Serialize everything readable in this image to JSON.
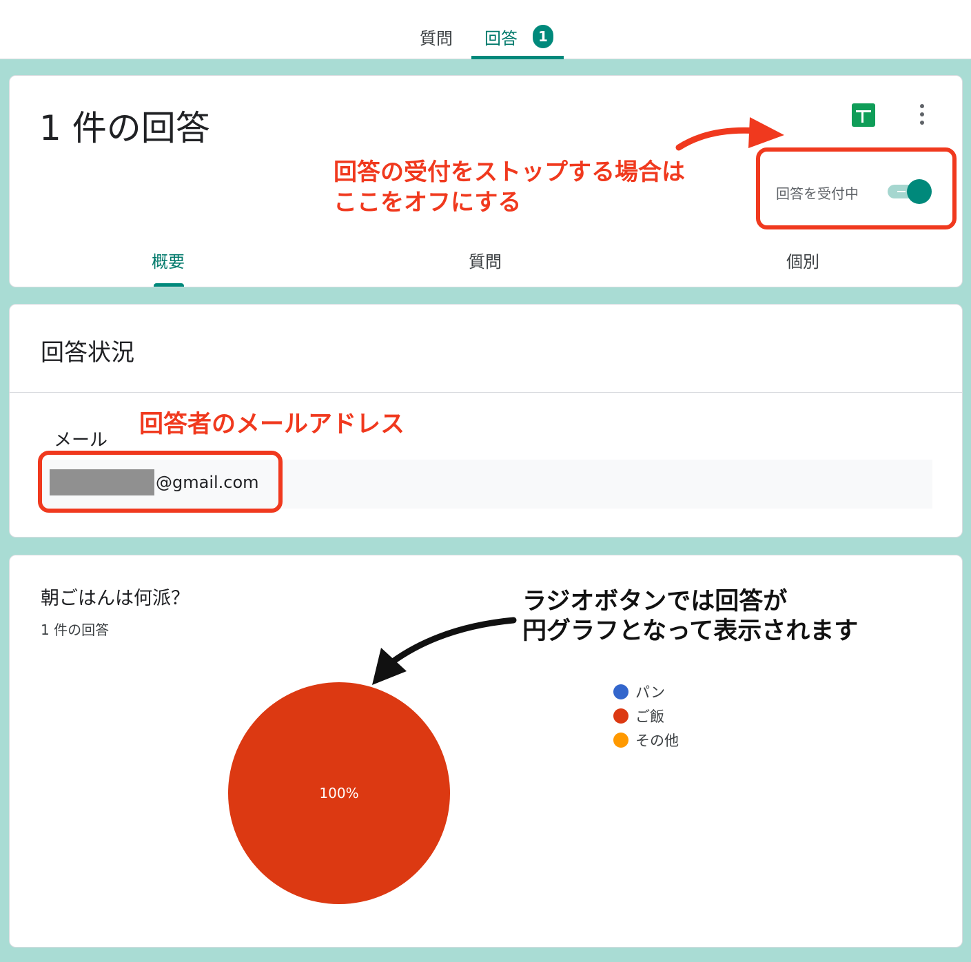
{
  "top_tabs": {
    "questions": "質問",
    "responses": "回答",
    "responses_count": "1"
  },
  "summary_card": {
    "title": "1 件の回答",
    "accepting_label": "回答を受付中",
    "accepting": true,
    "icons": [
      "sheets-icon",
      "more-vert-icon"
    ],
    "sub_tabs": [
      "概要",
      "質問",
      "個別"
    ],
    "active_sub_tab": "概要"
  },
  "status_card": {
    "title": "回答状況",
    "email_label": "メール",
    "email_domain": "@gmail.com"
  },
  "question_card": {
    "title": "朝ごはんは何派？",
    "count": "1 件の回答"
  },
  "chart_data": {
    "type": "pie",
    "categories": [
      "パン",
      "ご飯",
      "その他"
    ],
    "values": [
      0,
      100,
      0
    ],
    "data_label": "100%",
    "colors": [
      "#3366cc",
      "#dc3912",
      "#ff9900"
    ],
    "legend": "right"
  },
  "annotations": {
    "toggle_note_line1": "回答の受付をストップする場合は",
    "toggle_note_line2": "ここをオフにする",
    "email_note": "回答者のメールアドレス",
    "chart_note_line1": "ラジオボタンでは回答が",
    "chart_note_line2": "円グラフとなって表示されます",
    "colors": {
      "red": "#f0391e",
      "black": "#111111"
    }
  }
}
